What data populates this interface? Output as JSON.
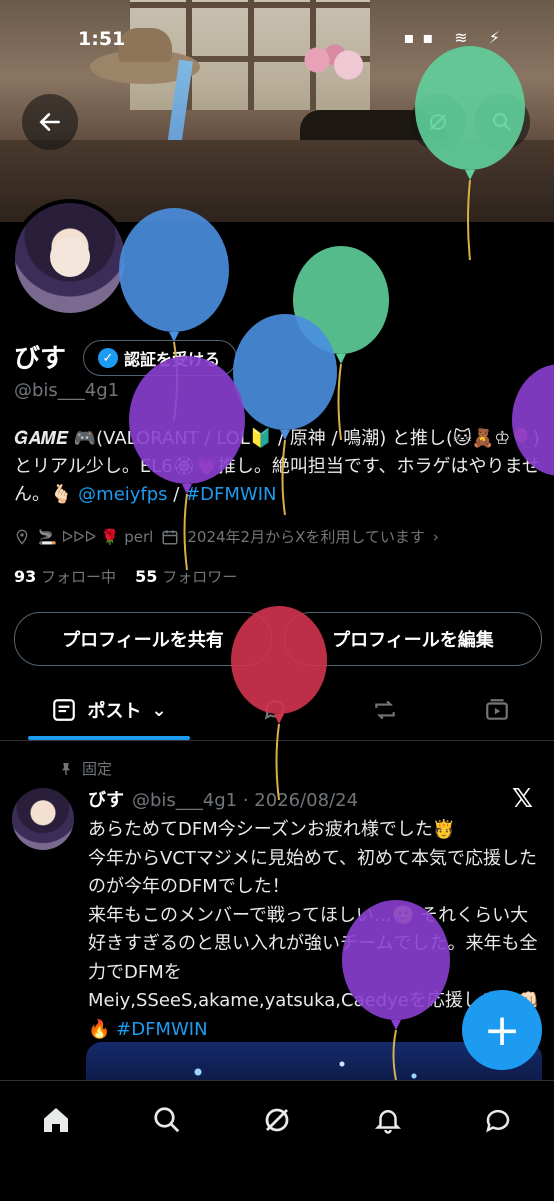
{
  "status_bar": {
    "time": "1:51"
  },
  "profile": {
    "name": "びす",
    "verify_label": "認証を受ける",
    "handle": "@bis___4g1",
    "bio_prefix": "𝑮𝑨𝑴𝑬 🎮(VALORANT / LOL🔰 / 原神 / 鳴潮) と推し(🐱🧸♔🎈)とリアル少し。EL6🏵💗推し。絶叫担当です、ホラゲはやりません。🫰🏻",
    "bio_mention": "@meiyfps",
    "bio_sep": " / ",
    "bio_hashtag": "#DFMWIN",
    "location": "🚬 ᐅᐅᐅ 🌹 perl",
    "joined": "2024年2月からXを利用しています",
    "following_count": "93",
    "following_label": "フォロー中",
    "followers_count": "55",
    "followers_label": "フォロワー",
    "share_button": "プロフィールを共有",
    "edit_button": "プロフィールを編集"
  },
  "tabs": {
    "posts": "ポスト"
  },
  "post": {
    "pinned_label": "固定",
    "author": "びす",
    "meta": "@bis___4g1 · 2026/08/24",
    "text": "あらためてDFM今シーズンお疲れ様でした🫅\n今年からVCTマジメに見始めて、初めて本気で応援したのが今年のDFMでした！\n来年もこのメンバーで戦ってほしい…🥲 それくらい大好きすぎるのと思い入れが強いチームでした。来年も全力でDFMを\nMeiy,SSeeS,akame,yatsuka,Caedyeを応援します👊🏻🔥 ",
    "hashtag": "#DFMWIN"
  },
  "colors": {
    "accent": "#1d9bf0",
    "background": "#000000"
  },
  "icons": [
    "back-arrow-icon",
    "grok-icon",
    "search-icon",
    "pin-icon",
    "x-logo-icon",
    "home-icon",
    "explore-icon",
    "grok-nav-icon",
    "notifications-icon",
    "messages-icon",
    "compose-icon"
  ]
}
